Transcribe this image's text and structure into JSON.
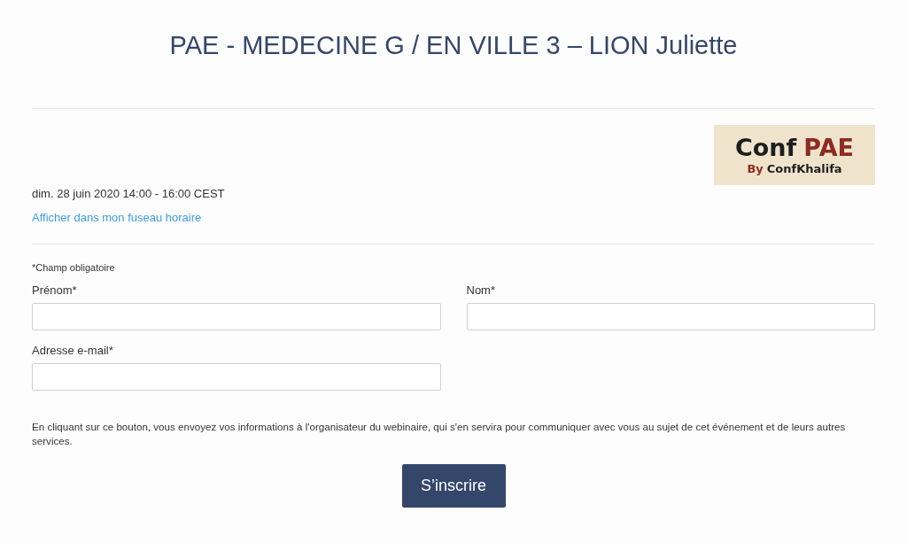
{
  "title": "PAE - MEDECINE G / EN VILLE 3 – LION Juliette",
  "logo": {
    "word": "Conf",
    "accent": "PAE",
    "byline_prefix": "By",
    "byline": "ConfKhalifa"
  },
  "event_time": "dim. 28 juin 2020 14:00 - 16:00 CEST",
  "timezone_link": "Afficher dans mon fuseau horaire",
  "required_note": "*Champ obligatoire",
  "fields": [
    {
      "label": "Prénom*"
    },
    {
      "label": "Nom*"
    },
    {
      "label": "Adresse e-mail*"
    }
  ],
  "consent_text": "En cliquant sur ce bouton, vous envoyez vos informations à l'organisateur du webinaire, qui s'en servira pour communiquer avec vous au sujet de cet événement et de leurs autres services.",
  "submit_button": "S’inscrire"
}
